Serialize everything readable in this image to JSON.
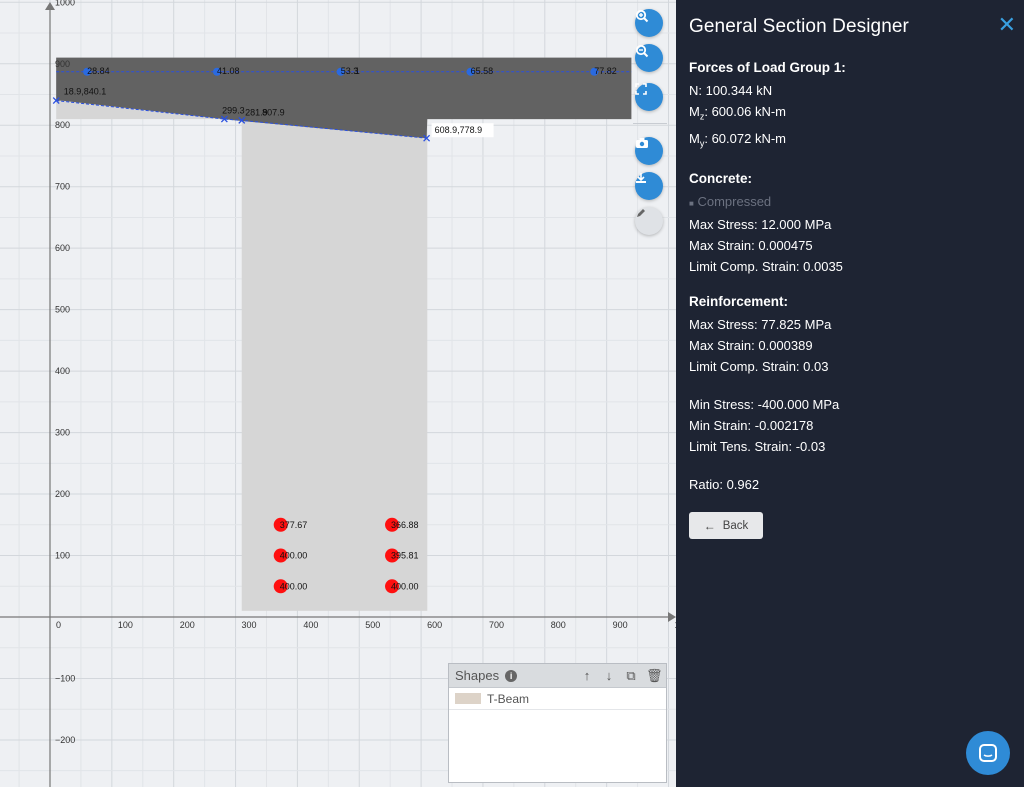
{
  "panel": {
    "title": "General Section Designer",
    "forces": {
      "title": "Forces of Load Group 1:",
      "n": "N: 100.344 kN",
      "mz_prefix": "M",
      "mz_sub": "z",
      "mz_value": ": 600.06 kN-m",
      "my_prefix": "M",
      "my_sub": "y",
      "my_value": ": 60.072 kN-m"
    },
    "concrete": {
      "title": "Concrete:",
      "legend": "Compressed",
      "max_stress": "Max Stress: 12.000 MPa",
      "max_strain": "Max Strain: 0.000475",
      "limit_comp": "Limit Comp. Strain: 0.0035"
    },
    "reinforcement": {
      "title": "Reinforcement:",
      "max_stress": "Max Stress: 77.825 MPa",
      "max_strain": "Max Strain: 0.000389",
      "limit_comp": "Limit Comp. Strain: 0.03",
      "min_stress": "Min Stress: -400.000 MPa",
      "min_strain": "Min Strain: -0.002178",
      "limit_tens": "Limit Tens. Strain: -0.03"
    },
    "ratio": "Ratio: 0.962",
    "back_label": "Back"
  },
  "shapes_panel": {
    "title": "Shapes",
    "items": [
      "T-Beam"
    ]
  },
  "axes": {
    "x_ticks": [
      "100",
      "0",
      "100",
      "200",
      "300",
      "400",
      "500",
      "600",
      "700",
      "800",
      "900",
      "10"
    ],
    "y_ticks": [
      "1000",
      "900",
      "800",
      "700",
      "600",
      "500",
      "400",
      "300",
      "200",
      "100",
      "−100",
      "−200"
    ]
  },
  "annotations": {
    "top_rebars": [
      "28.84",
      "41.08",
      "53.3",
      "1",
      "65.58",
      "77.82"
    ],
    "neutral_points": [
      "18.9,840.1",
      "299.3",
      "281.9",
      "807.9",
      "608.9,778.9"
    ],
    "bottom_rebars": [
      "377.67",
      "366.88",
      "400.00",
      "395.81",
      "400.00",
      "400.00"
    ]
  },
  "colors": {
    "accent": "#2f8bd6",
    "panel_bg": "#1e2433",
    "rebar": "#ff1010",
    "compression": "#555555",
    "section": "#d6d6d6"
  }
}
